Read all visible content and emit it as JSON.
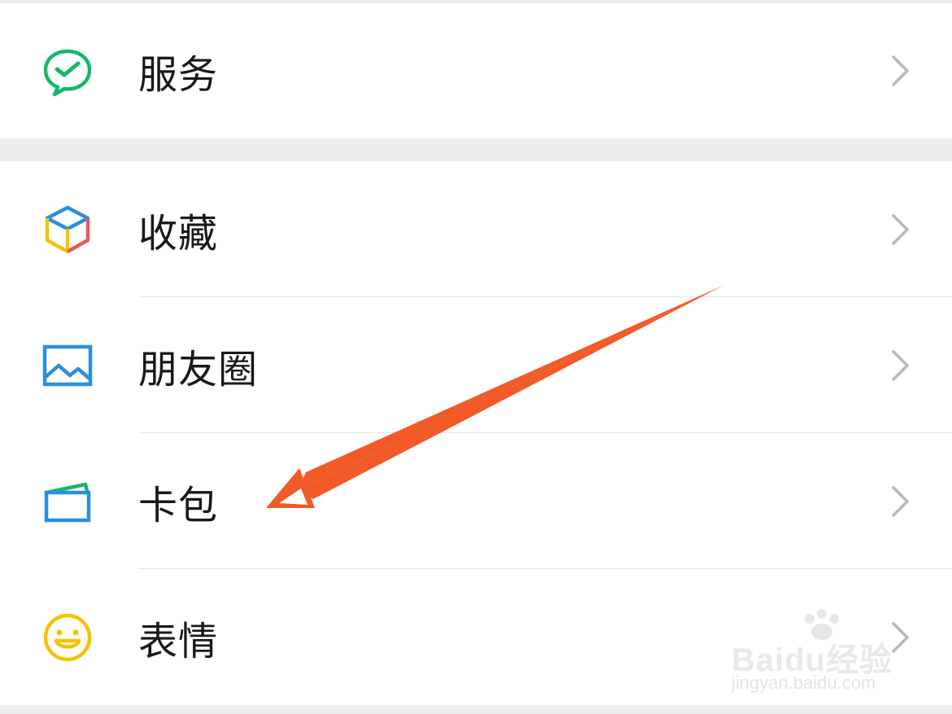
{
  "menu": {
    "group1": [
      {
        "label": "服务",
        "icon": "wechat-pay-icon",
        "color": "#09bb07"
      }
    ],
    "group2": [
      {
        "label": "收藏",
        "icon": "favorites-cube-icon",
        "color": "#2b8fe0"
      },
      {
        "label": "朋友圈",
        "icon": "moments-picture-icon",
        "color": "#2b8fe0"
      },
      {
        "label": "卡包",
        "icon": "card-wallet-icon",
        "color": "#2b8fe0"
      },
      {
        "label": "表情",
        "icon": "sticker-smiley-icon",
        "color": "#f5c300"
      }
    ]
  },
  "annotation": {
    "arrow_color": "#f25a28",
    "points_to": "卡包"
  },
  "watermark": {
    "brand": "Baidu经验",
    "url": "jingyan.baidu.com"
  }
}
